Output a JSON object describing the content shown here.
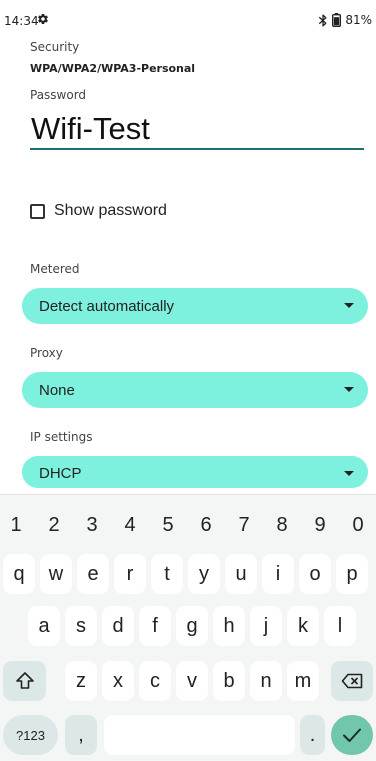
{
  "status_bar": {
    "time": "14:34",
    "settings_icon": "gear-icon",
    "bluetooth_icon": "bluetooth-icon",
    "battery_icon": "battery-icon",
    "battery_percent": "81%"
  },
  "form": {
    "security": {
      "label": "Security",
      "value": "WPA/WPA2/WPA3-Personal"
    },
    "password": {
      "label": "Password",
      "value": "Wifi-Test"
    },
    "show_password": {
      "label": "Show password",
      "checked": false
    },
    "metered": {
      "label": "Metered",
      "value": "Detect automatically"
    },
    "proxy": {
      "label": "Proxy",
      "value": "None"
    },
    "ip_settings": {
      "label": "IP settings",
      "value": "DHCP"
    }
  },
  "colors": {
    "dropdown_bg": "#7ef0de",
    "underline": "#1e6e6a",
    "enter_key": "#70c7ad"
  },
  "keyboard": {
    "numbers": [
      "1",
      "2",
      "3",
      "4",
      "5",
      "6",
      "7",
      "8",
      "9",
      "0"
    ],
    "row1": [
      "q",
      "w",
      "e",
      "r",
      "t",
      "y",
      "u",
      "i",
      "o",
      "p"
    ],
    "row2": [
      "a",
      "s",
      "d",
      "f",
      "g",
      "h",
      "j",
      "k",
      "l"
    ],
    "row3": [
      "z",
      "x",
      "c",
      "v",
      "b",
      "n",
      "m"
    ],
    "shift_icon": "shift-icon",
    "backspace_icon": "backspace-icon",
    "symbols_label": "?123",
    "comma_label": ",",
    "period_label": ".",
    "enter_icon": "checkmark-icon"
  }
}
